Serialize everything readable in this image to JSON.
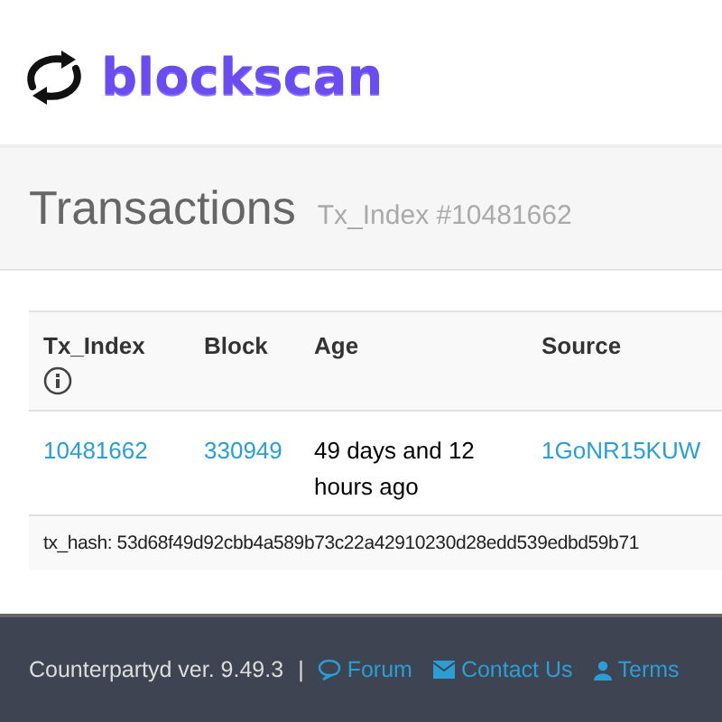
{
  "logo": {
    "text": "blockscan"
  },
  "page_header": {
    "title": "Transactions",
    "subtitle": "Tx_Index #10481662"
  },
  "table": {
    "columns": [
      {
        "label": "Tx_Index",
        "info": true
      },
      {
        "label": "Block",
        "info": false
      },
      {
        "label": "Age",
        "info": false
      },
      {
        "label": "Source",
        "info": false
      }
    ],
    "rows": [
      {
        "cells": [
          {
            "text": "10481662",
            "kind": "link"
          },
          {
            "text": "330949",
            "kind": "link"
          },
          {
            "text": "49 days and 12 hours ago",
            "kind": "text"
          },
          {
            "text": "1GoNR15KUW",
            "kind": "link"
          }
        ]
      }
    ],
    "hash": "tx_hash: 53d68f49d92cbb4a589b73c22a42910230d28edd539edbd59b71"
  },
  "footer": {
    "version": "Counterpartyd ver. 9.49.3",
    "separator": "|",
    "links": [
      {
        "label": "Forum",
        "kind": "chat"
      },
      {
        "label": "Contact Us",
        "kind": "mail"
      },
      {
        "label": "Terms",
        "kind": "user"
      }
    ]
  }
}
